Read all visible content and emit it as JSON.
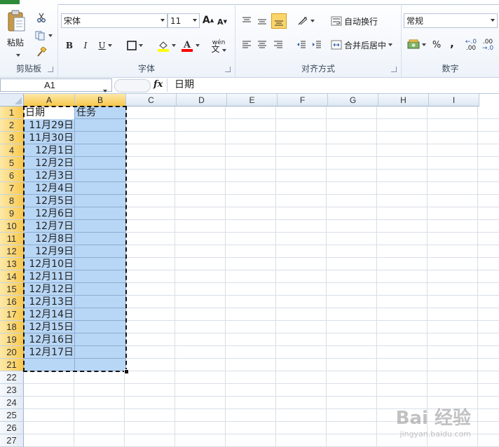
{
  "ribbon": {
    "clipboard": {
      "label": "剪贴板",
      "paste_label": "粘贴"
    },
    "font": {
      "label": "字体",
      "name": "宋体",
      "size": "11",
      "bold": "B",
      "italic": "I",
      "underline": "U",
      "grow": "A",
      "shrink": "A",
      "phonetic": "wén",
      "fill_color": "#ffff00",
      "font_color": "#ff0000"
    },
    "alignment": {
      "label": "对齐方式",
      "wrap_text": "自动换行",
      "merge_center": "合并后居中"
    },
    "number": {
      "label": "数字",
      "format": "常规",
      "percent": "%",
      "comma": ",",
      "inc_decimal": ".00",
      "dec_decimal": ".0"
    }
  },
  "formula_bar": {
    "name_box": "A1",
    "fx": "fx",
    "formula": "日期"
  },
  "sheet": {
    "columns": [
      "A",
      "B",
      "C",
      "D",
      "E",
      "F",
      "G",
      "H",
      "I"
    ],
    "rows": [
      "1",
      "2",
      "3",
      "4",
      "5",
      "6",
      "7",
      "8",
      "9",
      "10",
      "11",
      "12",
      "13",
      "14",
      "15",
      "16",
      "17",
      "18",
      "19",
      "20",
      "21",
      "22",
      "23",
      "24",
      "25",
      "26",
      "27"
    ],
    "headers": {
      "a1": "日期",
      "b1": "任务"
    },
    "dates": [
      "11月29日",
      "11月30日",
      "12月1日",
      "12月2日",
      "12月3日",
      "12月4日",
      "12月5日",
      "12月6日",
      "12月7日",
      "12月8日",
      "12月9日",
      "12月10日",
      "12月11日",
      "12月12日",
      "12月13日",
      "12月14日",
      "12月15日",
      "12月16日",
      "12月17日"
    ],
    "selection_color": "#b8d6f5",
    "header_highlight": "#f8c84e"
  },
  "watermark": {
    "text": "Bai 经验",
    "sub": "jingyan.baidu.com"
  }
}
